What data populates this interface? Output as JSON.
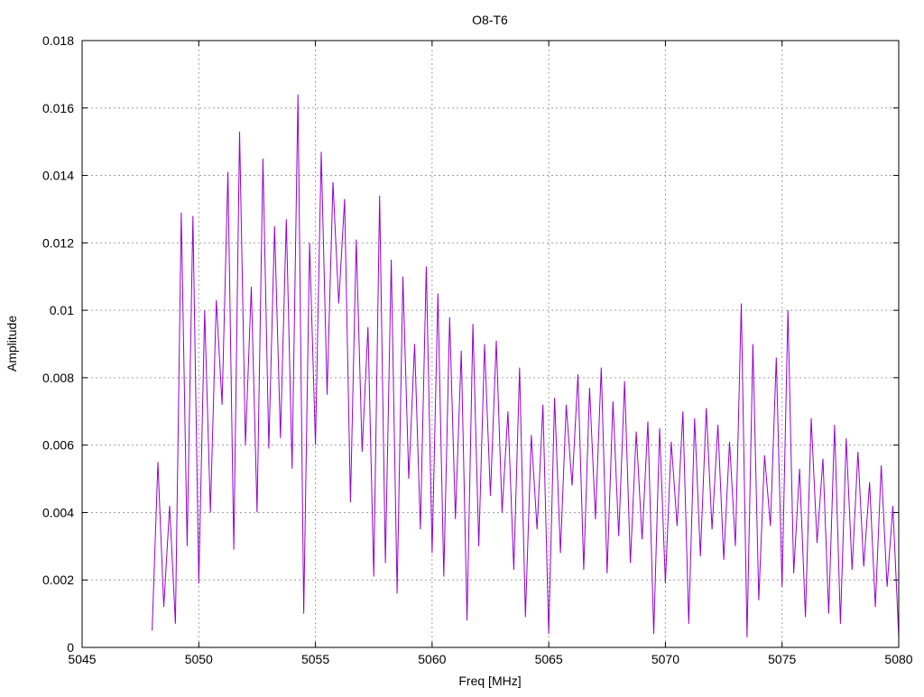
{
  "chart_data": {
    "type": "line",
    "title": "O8-T6",
    "xlabel": "Freq [MHz]",
    "ylabel": "Amplitude",
    "xlim": [
      5045,
      5080
    ],
    "ylim": [
      0,
      0.018
    ],
    "grid": true,
    "legend": "none",
    "xticks": [
      "5045",
      "5050",
      "5055",
      "5060",
      "5065",
      "5070",
      "5075",
      "5080"
    ],
    "xtick_values": [
      5045,
      5050,
      5055,
      5060,
      5065,
      5070,
      5075,
      5080
    ],
    "yticks": [
      "0",
      "0.002",
      "0.004",
      "0.006",
      "0.008",
      "0.01",
      "0.012",
      "0.014",
      "0.016",
      "0.018"
    ],
    "ytick_values": [
      0,
      0.002,
      0.004,
      0.006,
      0.008,
      0.01,
      0.012,
      0.014,
      0.016,
      0.018
    ],
    "series": [
      {
        "name": "O8-T6",
        "color": "#9400d3",
        "x_start": 5048,
        "x_step": 0.25,
        "values": [
          0.0005,
          0.0055,
          0.0012,
          0.0042,
          0.0007,
          0.0129,
          0.003,
          0.0128,
          0.0019,
          0.01,
          0.004,
          0.0103,
          0.0072,
          0.0141,
          0.0029,
          0.0153,
          0.006,
          0.0107,
          0.004,
          0.0145,
          0.0059,
          0.0125,
          0.0062,
          0.0127,
          0.0053,
          0.0164,
          0.001,
          0.012,
          0.006,
          0.0147,
          0.0075,
          0.0138,
          0.0102,
          0.0133,
          0.0043,
          0.0121,
          0.0058,
          0.0095,
          0.0021,
          0.0134,
          0.0025,
          0.0115,
          0.0016,
          0.011,
          0.005,
          0.009,
          0.0035,
          0.0113,
          0.0028,
          0.0105,
          0.0021,
          0.0098,
          0.0038,
          0.0088,
          0.0008,
          0.0096,
          0.003,
          0.009,
          0.0045,
          0.0091,
          0.004,
          0.007,
          0.0023,
          0.0083,
          0.0009,
          0.0063,
          0.0035,
          0.0072,
          0.0004,
          0.0074,
          0.0028,
          0.0072,
          0.0048,
          0.0081,
          0.0023,
          0.0077,
          0.0038,
          0.0083,
          0.0022,
          0.0073,
          0.0033,
          0.0079,
          0.0025,
          0.0064,
          0.0032,
          0.0067,
          0.0004,
          0.0065,
          0.0019,
          0.0061,
          0.0036,
          0.007,
          0.0007,
          0.0068,
          0.0027,
          0.0071,
          0.0035,
          0.0066,
          0.0026,
          0.0061,
          0.003,
          0.0102,
          0.0003,
          0.009,
          0.0014,
          0.0057,
          0.0036,
          0.0086,
          0.0018,
          0.01,
          0.0022,
          0.0053,
          0.0009,
          0.0068,
          0.0031,
          0.0056,
          0.001,
          0.0066,
          0.0007,
          0.0062,
          0.0023,
          0.0058,
          0.0024,
          0.0049,
          0.0012,
          0.0054,
          0.0018,
          0.0042,
          0.0003
        ]
      }
    ]
  }
}
